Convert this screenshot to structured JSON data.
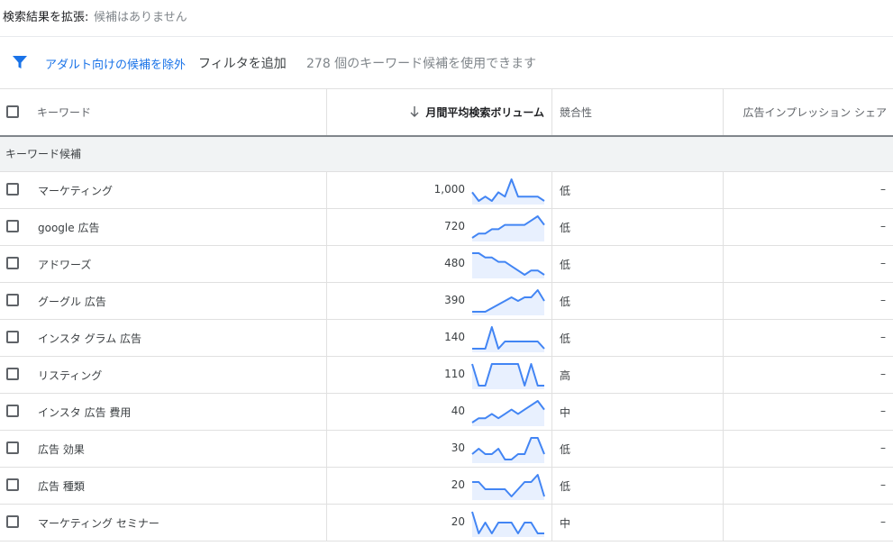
{
  "expand": {
    "label": "検索結果を拡張:",
    "value": "候補はありません"
  },
  "filters": {
    "adult_chip": "アダルト向けの候補を除外",
    "add_filter": "フィルタを追加",
    "available": "278 個のキーワード候補を使用できます"
  },
  "columns": {
    "keyword": "キーワード",
    "volume": "月間平均検索ボリューム",
    "competition": "競合性",
    "impression_share": "広告インプレッション シェア"
  },
  "group_label": "キーワード候補",
  "colors": {
    "accent": "#1a73e8",
    "spark_line": "#4285f4",
    "spark_fill": "#e8f0fe"
  },
  "rows": [
    {
      "keyword": "マーケティング",
      "volume": "1,000",
      "competition": "低",
      "share": "–",
      "trend": [
        3,
        1,
        2,
        1,
        3,
        2,
        6,
        2,
        2,
        2,
        2,
        1
      ]
    },
    {
      "keyword": "google 広告",
      "volume": "720",
      "competition": "低",
      "share": "–",
      "trend": [
        1,
        2,
        2,
        3,
        3,
        4,
        4,
        4,
        4,
        5,
        6,
        4
      ]
    },
    {
      "keyword": "アドワーズ",
      "volume": "480",
      "competition": "低",
      "share": "–",
      "trend": [
        6,
        6,
        5,
        5,
        4,
        4,
        3,
        2,
        1,
        2,
        2,
        1
      ]
    },
    {
      "keyword": "グーグル 広告",
      "volume": "390",
      "competition": "低",
      "share": "–",
      "trend": [
        1,
        1,
        1,
        2,
        3,
        4,
        5,
        4,
        5,
        5,
        7,
        4
      ]
    },
    {
      "keyword": "インスタ グラム 広告",
      "volume": "140",
      "competition": "低",
      "share": "–",
      "trend": [
        1,
        1,
        1,
        4,
        1,
        2,
        2,
        2,
        2,
        2,
        2,
        1
      ]
    },
    {
      "keyword": "リスティング",
      "volume": "110",
      "competition": "高",
      "share": "–",
      "trend": [
        3,
        1,
        1,
        3,
        3,
        3,
        3,
        3,
        1,
        3,
        1,
        1
      ]
    },
    {
      "keyword": "インスタ 広告 費用",
      "volume": "40",
      "competition": "中",
      "share": "–",
      "trend": [
        1,
        2,
        2,
        3,
        2,
        3,
        4,
        3,
        4,
        5,
        6,
        4
      ]
    },
    {
      "keyword": "広告 効果",
      "volume": "30",
      "competition": "低",
      "share": "–",
      "trend": [
        2,
        3,
        2,
        2,
        3,
        1,
        1,
        2,
        2,
        5,
        5,
        2
      ]
    },
    {
      "keyword": "広告 種類",
      "volume": "20",
      "competition": "低",
      "share": "–",
      "trend": [
        4,
        4,
        3,
        3,
        3,
        3,
        2,
        3,
        4,
        4,
        5,
        2
      ]
    },
    {
      "keyword": "マーケティング セミナー",
      "volume": "20",
      "competition": "中",
      "share": "–",
      "trend": [
        4,
        2,
        3,
        2,
        3,
        3,
        3,
        2,
        3,
        3,
        2,
        2
      ]
    }
  ]
}
